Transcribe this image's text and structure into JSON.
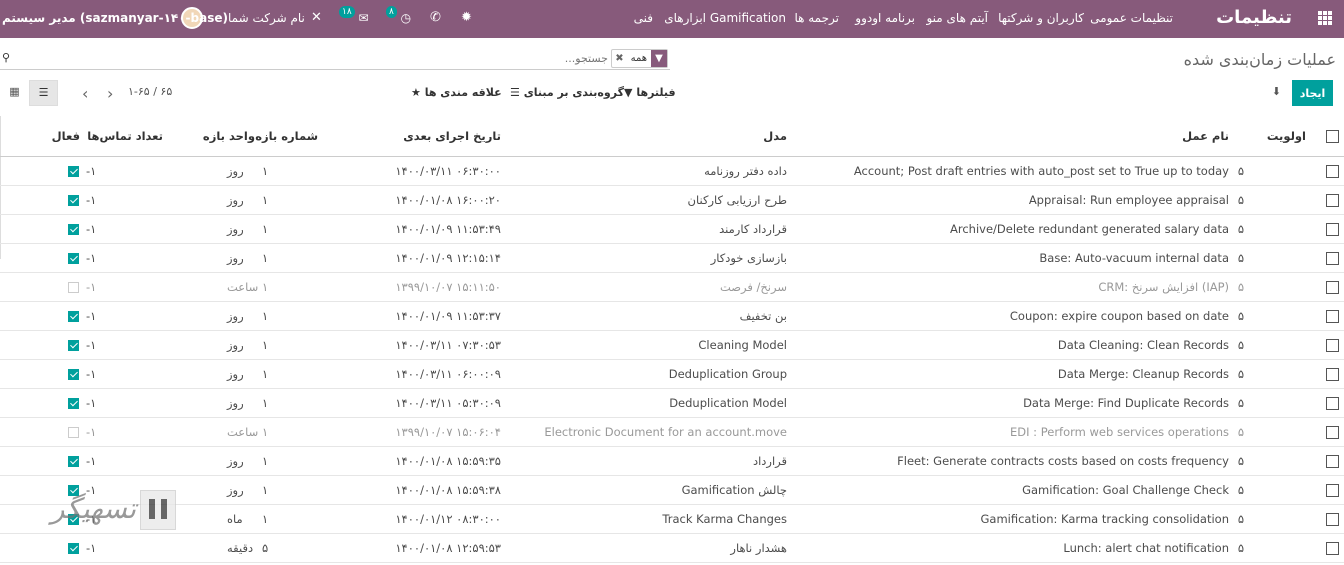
{
  "nav": {
    "app_title": "تنظیمات",
    "menu": [
      "تنظیمات عمومی",
      "کاربران و شرکتها",
      "آیتم های منو",
      "برنامه اودوو",
      "ترجمه ها",
      "ابزارهای Gamification",
      "فنی"
    ],
    "activity_badge": "۸",
    "messages_badge": "۱۸",
    "company": "نام شرکت شما",
    "user": "مدیر سیستم (sazmanyar-۱۴۰-base)"
  },
  "control": {
    "breadcrumb": "عملیات زمان‌بندی شده",
    "facet_label": "همه",
    "search_placeholder": "جستجو...",
    "create_label": "ایجاد",
    "filters_label": "فیلترها",
    "groupby_label": "گروه‌بندی بر مبنای",
    "favorites_label": "علاقه مندی ها",
    "pager_range": "۱-۶۵",
    "pager_total": "۶۵"
  },
  "columns": {
    "priority": "اولویت",
    "name": "نام عمل",
    "model": "مدل",
    "nextcall": "تاریخ اجرای بعدی",
    "interval_number": "شماره بازه",
    "interval_type": "واحد بازه",
    "numbercall": "تعداد تماس‌ها",
    "active": "فعال"
  },
  "rows": [
    {
      "priority": "۵",
      "name": "Account; Post draft entries with auto_post set to True up to today",
      "model": "داده دفتر روزنامه",
      "nextcall": "۱۴۰۰/۰۳/۱۱ ۰۶:۳۰:۰۰",
      "interval_number": "۱",
      "interval_type": "روز",
      "numbercall": "-۱",
      "active": true
    },
    {
      "priority": "۵",
      "name": "Appraisal: Run employee appraisal",
      "model": "طرح ارزیابی کارکنان",
      "nextcall": "۱۴۰۰/۰۱/۰۸ ۱۶:۰۰:۲۰",
      "interval_number": "۱",
      "interval_type": "روز",
      "numbercall": "-۱",
      "active": true
    },
    {
      "priority": "۵",
      "name": "Archive/Delete redundant generated salary data",
      "model": "قرارداد کارمند",
      "nextcall": "۱۴۰۰/۰۱/۰۹ ۱۱:۵۳:۴۹",
      "interval_number": "۱",
      "interval_type": "روز",
      "numbercall": "-۱",
      "active": true
    },
    {
      "priority": "۵",
      "name": "Base: Auto-vacuum internal data",
      "model": "بازسازی خودکار",
      "nextcall": "۱۴۰۰/۰۱/۰۹ ۱۲:۱۵:۱۴",
      "interval_number": "۱",
      "interval_type": "روز",
      "numbercall": "-۱",
      "active": true
    },
    {
      "priority": "۵",
      "name": "CRM: افزایش سرنخ (IAP)",
      "model": "سرنخ/ فرصت",
      "nextcall": "۱۳۹۹/۱۰/۰۷ ۱۵:۱۱:۵۰",
      "interval_number": "۱",
      "interval_type": "ساعت",
      "numbercall": "-۱",
      "active": false
    },
    {
      "priority": "۵",
      "name": "Coupon: expire coupon based on date",
      "model": "بن تخفیف",
      "nextcall": "۱۴۰۰/۰۱/۰۹ ۱۱:۵۳:۳۷",
      "interval_number": "۱",
      "interval_type": "روز",
      "numbercall": "-۱",
      "active": true
    },
    {
      "priority": "۵",
      "name": "Data Cleaning: Clean Records",
      "model": "Cleaning Model",
      "nextcall": "۱۴۰۰/۰۳/۱۱ ۰۷:۳۰:۵۳",
      "interval_number": "۱",
      "interval_type": "روز",
      "numbercall": "-۱",
      "active": true
    },
    {
      "priority": "۵",
      "name": "Data Merge: Cleanup Records",
      "model": "Deduplication Group",
      "nextcall": "۱۴۰۰/۰۳/۱۱ ۰۶:۰۰:۰۹",
      "interval_number": "۱",
      "interval_type": "روز",
      "numbercall": "-۱",
      "active": true
    },
    {
      "priority": "۵",
      "name": "Data Merge: Find Duplicate Records",
      "model": "Deduplication Model",
      "nextcall": "۱۴۰۰/۰۳/۱۱ ۰۵:۳۰:۰۹",
      "interval_number": "۱",
      "interval_type": "روز",
      "numbercall": "-۱",
      "active": true
    },
    {
      "priority": "۵",
      "name": "EDI : Perform web services operations",
      "model": "Electronic Document for an account.move",
      "nextcall": "۱۳۹۹/۱۰/۰۷ ۱۵:۰۶:۰۴",
      "interval_number": "۱",
      "interval_type": "ساعت",
      "numbercall": "-۱",
      "active": false
    },
    {
      "priority": "۵",
      "name": "Fleet: Generate contracts costs based on costs frequency",
      "model": "قرارداد",
      "nextcall": "۱۴۰۰/۰۱/۰۸ ۱۵:۵۹:۳۵",
      "interval_number": "۱",
      "interval_type": "روز",
      "numbercall": "-۱",
      "active": true
    },
    {
      "priority": "۵",
      "name": "Gamification: Goal Challenge Check",
      "model": "Gamification چالش",
      "nextcall": "۱۴۰۰/۰۱/۰۸ ۱۵:۵۹:۳۸",
      "interval_number": "۱",
      "interval_type": "روز",
      "numbercall": "-۱",
      "active": true
    },
    {
      "priority": "۵",
      "name": "Gamification: Karma tracking consolidation",
      "model": "Track Karma Changes",
      "nextcall": "۱۴۰۰/۰۱/۱۲ ۰۸:۳۰:۰۰",
      "interval_number": "۱",
      "interval_type": "ماه",
      "numbercall": "-۱",
      "active": true
    },
    {
      "priority": "۵",
      "name": "Lunch: alert chat notification",
      "model": "هشدار ناهار",
      "nextcall": "۱۴۰۰/۰۱/۰۸ ۱۲:۵۹:۵۳",
      "interval_number": "۵",
      "interval_type": "دقیقه",
      "numbercall": "-۱",
      "active": true
    }
  ],
  "colors": {
    "brand": "#875a7b",
    "accent": "#00a09d"
  }
}
